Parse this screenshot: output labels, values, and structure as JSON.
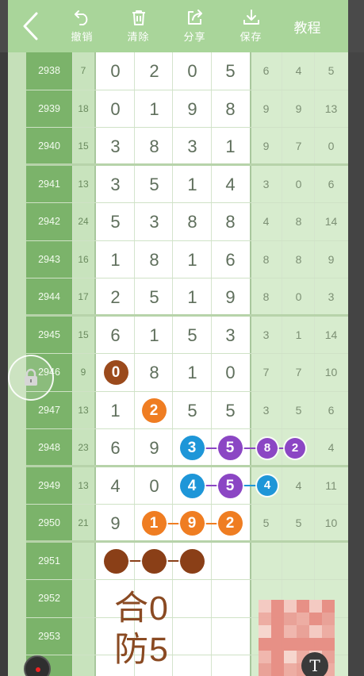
{
  "toolbar": {
    "undo_label": "撤销",
    "clear_label": "清除",
    "share_label": "分享",
    "save_label": "保存",
    "tutorial_label": "教程"
  },
  "rows": [
    {
      "period": "2938",
      "sum": "7",
      "digits": [
        "0",
        "2",
        "0",
        "5"
      ],
      "tails": [
        "6",
        "4",
        "5"
      ]
    },
    {
      "period": "2939",
      "sum": "18",
      "digits": [
        "0",
        "1",
        "9",
        "8"
      ],
      "tails": [
        "9",
        "9",
        "13"
      ]
    },
    {
      "period": "2940",
      "sum": "15",
      "digits": [
        "3",
        "8",
        "3",
        "1"
      ],
      "tails": [
        "9",
        "7",
        "0"
      ]
    },
    {
      "period": "2941",
      "sum": "13",
      "digits": [
        "3",
        "5",
        "1",
        "4"
      ],
      "tails": [
        "3",
        "0",
        "6"
      ]
    },
    {
      "period": "2942",
      "sum": "24",
      "digits": [
        "5",
        "3",
        "8",
        "8"
      ],
      "tails": [
        "4",
        "8",
        "14"
      ]
    },
    {
      "period": "2943",
      "sum": "16",
      "digits": [
        "1",
        "8",
        "1",
        "6"
      ],
      "tails": [
        "8",
        "8",
        "9"
      ]
    },
    {
      "period": "2944",
      "sum": "17",
      "digits": [
        "2",
        "5",
        "1",
        "9"
      ],
      "tails": [
        "8",
        "0",
        "3"
      ]
    },
    {
      "period": "2945",
      "sum": "15",
      "digits": [
        "6",
        "1",
        "5",
        "3"
      ],
      "tails": [
        "3",
        "1",
        "14"
      ]
    },
    {
      "period": "2946",
      "sum": "9",
      "digits": [
        "",
        "8",
        "1",
        "0"
      ],
      "tails": [
        "7",
        "7",
        "10"
      ]
    },
    {
      "period": "2947",
      "sum": "13",
      "digits": [
        "1",
        "",
        "5",
        "5"
      ],
      "tails": [
        "3",
        "5",
        "6"
      ]
    },
    {
      "period": "2948",
      "sum": "23",
      "digits": [
        "6",
        "9",
        "",
        ""
      ],
      "tails": [
        "",
        "",
        "4"
      ]
    },
    {
      "period": "2949",
      "sum": "13",
      "digits": [
        "4",
        "0",
        "",
        ""
      ],
      "tails": [
        "",
        "4",
        "11"
      ]
    },
    {
      "period": "2950",
      "sum": "21",
      "digits": [
        "9",
        "",
        "",
        ""
      ],
      "tails": [
        "5",
        "5",
        "10"
      ]
    },
    {
      "period": "2951",
      "sum": "",
      "digits": [
        "",
        "",
        "",
        ""
      ],
      "tails": [
        "",
        "",
        ""
      ]
    },
    {
      "period": "2952",
      "sum": "",
      "digits": [
        "",
        "",
        "",
        ""
      ],
      "tails": [
        "",
        "",
        ""
      ]
    },
    {
      "period": "2953",
      "sum": "",
      "digits": [
        "",
        "",
        "",
        ""
      ],
      "tails": [
        "",
        "",
        ""
      ]
    }
  ],
  "balls": [
    {
      "row": 8,
      "col": 0,
      "text": "0",
      "color": "#9b4a1c"
    },
    {
      "row": 9,
      "col": 1,
      "text": "2",
      "color": "#ef7d22"
    },
    {
      "row": 10,
      "col": 2,
      "text": "3",
      "color": "#1e96d8"
    },
    {
      "row": 10,
      "col": 3,
      "text": "5",
      "color": "#8b46c4"
    },
    {
      "row": 10,
      "col": 4,
      "text": "8",
      "color": "#8b46c4",
      "small": true
    },
    {
      "row": 10,
      "col": 5,
      "text": "2",
      "color": "#8b46c4",
      "small": true
    },
    {
      "row": 11,
      "col": 2,
      "text": "4",
      "color": "#1e96d8"
    },
    {
      "row": 11,
      "col": 3,
      "text": "5",
      "color": "#8b46c4"
    },
    {
      "row": 11,
      "col": 4,
      "text": "4",
      "color": "#1e96d8",
      "small": true
    },
    {
      "row": 12,
      "col": 1,
      "text": "1",
      "color": "#ef7d22"
    },
    {
      "row": 12,
      "col": 2,
      "text": "9",
      "color": "#ef7d22"
    },
    {
      "row": 12,
      "col": 3,
      "text": "2",
      "color": "#ef7d22"
    },
    {
      "row": 13,
      "col": 0,
      "text": "",
      "color": "#8a3f17"
    },
    {
      "row": 13,
      "col": 1,
      "text": "",
      "color": "#8a3f17"
    },
    {
      "row": 13,
      "col": 2,
      "text": "",
      "color": "#8a3f17"
    }
  ],
  "notes": {
    "line1": "合0",
    "line2": "防5"
  },
  "colors": {
    "toolbar": "#a9d59a",
    "period_column": "#7bb36a",
    "brown": "#8a4a22"
  },
  "icons": {
    "back": "chevron-left-icon",
    "undo": "undo-icon",
    "clear": "trash-icon",
    "share": "share-icon",
    "save": "save-icon",
    "lock": "lock-icon"
  }
}
